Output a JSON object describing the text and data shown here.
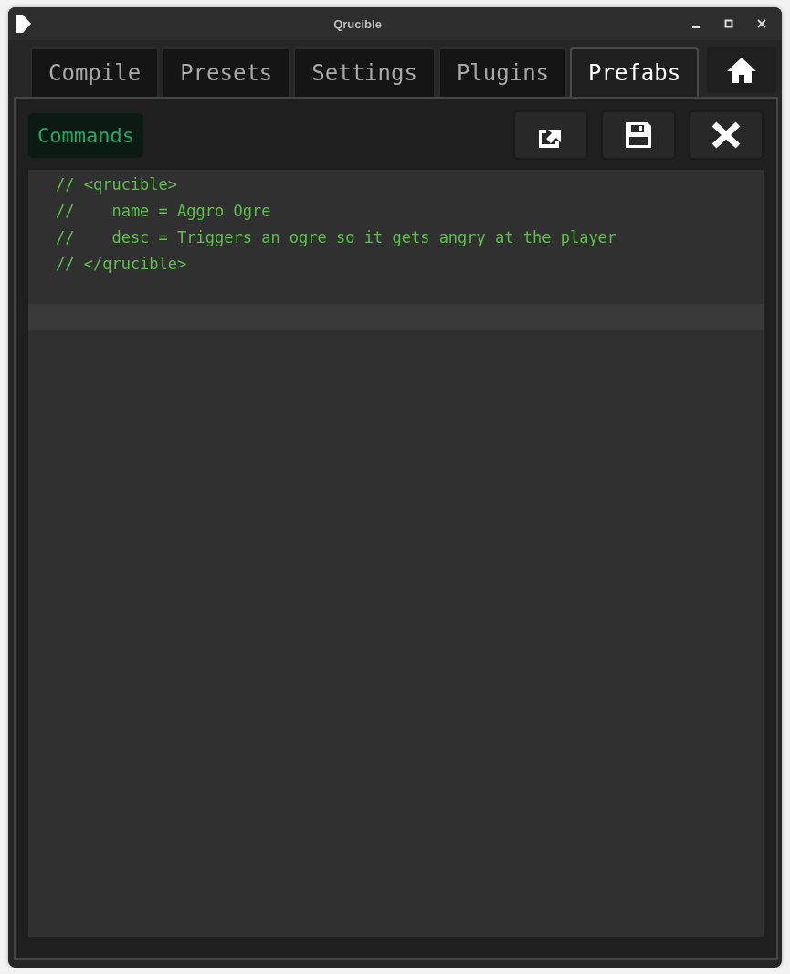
{
  "window": {
    "title": "Qrucible"
  },
  "tabs": [
    {
      "label": "Compile",
      "selected": false
    },
    {
      "label": "Presets",
      "selected": false
    },
    {
      "label": "Settings",
      "selected": false
    },
    {
      "label": "Plugins",
      "selected": false
    },
    {
      "label": "Prefabs",
      "selected": true
    }
  ],
  "panel": {
    "title": "Commands"
  },
  "editor": {
    "lines": [
      "// <qrucible>",
      "//    name = Aggro Ogre",
      "//    desc = Triggers an ogre so it gets angry at the player",
      "// </qrucible>"
    ]
  }
}
